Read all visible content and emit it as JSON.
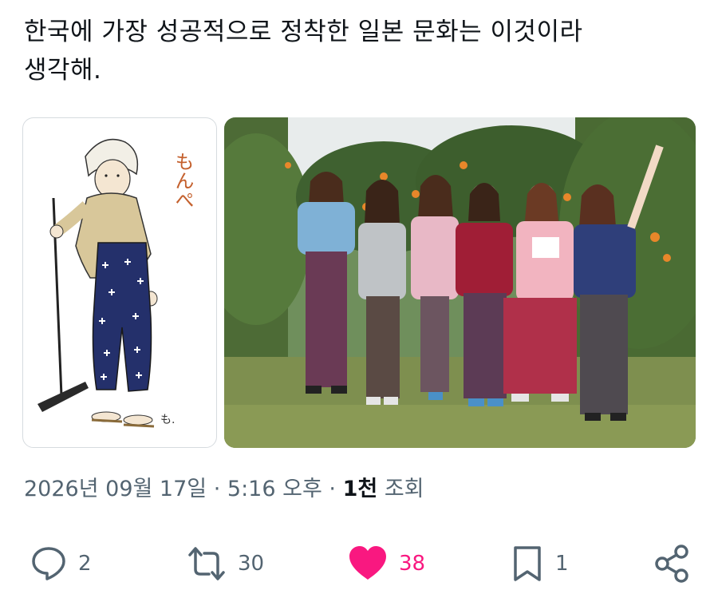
{
  "tweet": {
    "text": "한국에 가장 성공적으로 정착한 일본 문화는 이것이라\n생각해."
  },
  "media": {
    "illustration_caption": "もんぺ",
    "illustration_signature": "も."
  },
  "meta": {
    "date": "2026년 09월 17일",
    "sep1": "·",
    "time": "5:16 오후",
    "sep2": "·",
    "views_count": "1천",
    "views_label": "조회"
  },
  "actions": {
    "reply_count": "2",
    "retweet_count": "30",
    "like_count": "38",
    "bookmark_count": "1"
  },
  "colors": {
    "like_accent": "#f91880",
    "meta_gray": "#536471",
    "text_dark": "#0f1419"
  },
  "icons": {
    "reply": "reply-icon",
    "retweet": "retweet-icon",
    "like": "heart-icon",
    "bookmark": "bookmark-icon",
    "share": "share-icon"
  }
}
